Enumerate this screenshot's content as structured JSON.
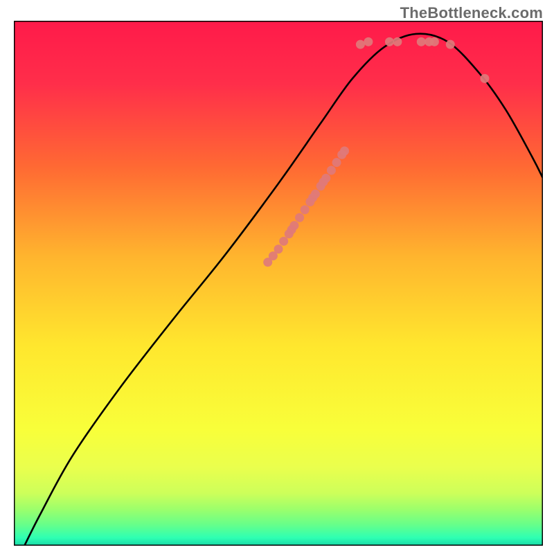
{
  "watermark": "TheBottleneck.com",
  "chart_data": {
    "type": "line",
    "title": "",
    "xlabel": "",
    "ylabel": "",
    "xlim": [
      0,
      100
    ],
    "ylim": [
      0,
      100
    ],
    "gradient_stops": [
      {
        "offset": 0.0,
        "color": "#ff1a4a"
      },
      {
        "offset": 0.12,
        "color": "#ff2e4a"
      },
      {
        "offset": 0.28,
        "color": "#ff6a33"
      },
      {
        "offset": 0.45,
        "color": "#ffb52e"
      },
      {
        "offset": 0.62,
        "color": "#ffe72e"
      },
      {
        "offset": 0.78,
        "color": "#f8ff3a"
      },
      {
        "offset": 0.85,
        "color": "#eaff4d"
      },
      {
        "offset": 0.9,
        "color": "#cdff5a"
      },
      {
        "offset": 0.93,
        "color": "#9dff6b"
      },
      {
        "offset": 0.96,
        "color": "#66ff8a"
      },
      {
        "offset": 0.985,
        "color": "#2effb3"
      },
      {
        "offset": 1.0,
        "color": "#18d9a8"
      }
    ],
    "curve": [
      {
        "x": 2.0,
        "y": 0.0
      },
      {
        "x": 5.0,
        "y": 6.0
      },
      {
        "x": 11.0,
        "y": 17.0
      },
      {
        "x": 20.0,
        "y": 30.0
      },
      {
        "x": 30.0,
        "y": 43.0
      },
      {
        "x": 40.0,
        "y": 55.5
      },
      {
        "x": 50.0,
        "y": 69.0
      },
      {
        "x": 58.0,
        "y": 80.5
      },
      {
        "x": 64.0,
        "y": 89.0
      },
      {
        "x": 70.0,
        "y": 95.0
      },
      {
        "x": 76.0,
        "y": 97.5
      },
      {
        "x": 82.0,
        "y": 96.0
      },
      {
        "x": 88.0,
        "y": 90.0
      },
      {
        "x": 93.0,
        "y": 83.0
      },
      {
        "x": 98.0,
        "y": 74.0
      },
      {
        "x": 100.0,
        "y": 70.0
      }
    ],
    "markers": [
      {
        "x": 48.0,
        "y": 54.0
      },
      {
        "x": 49.0,
        "y": 55.2
      },
      {
        "x": 50.0,
        "y": 56.5
      },
      {
        "x": 51.0,
        "y": 58.0
      },
      {
        "x": 52.0,
        "y": 59.4
      },
      {
        "x": 52.5,
        "y": 60.2
      },
      {
        "x": 53.0,
        "y": 61.0
      },
      {
        "x": 54.0,
        "y": 62.5
      },
      {
        "x": 55.0,
        "y": 64.0
      },
      {
        "x": 56.0,
        "y": 65.5
      },
      {
        "x": 56.5,
        "y": 66.3
      },
      {
        "x": 57.0,
        "y": 67.0
      },
      {
        "x": 58.0,
        "y": 68.5
      },
      {
        "x": 58.5,
        "y": 69.3
      },
      {
        "x": 59.0,
        "y": 70.0
      },
      {
        "x": 60.0,
        "y": 71.5
      },
      {
        "x": 61.0,
        "y": 73.0
      },
      {
        "x": 62.0,
        "y": 74.5
      },
      {
        "x": 62.5,
        "y": 75.2
      },
      {
        "x": 65.5,
        "y": 95.5
      },
      {
        "x": 67.0,
        "y": 96.0
      },
      {
        "x": 71.0,
        "y": 96.0
      },
      {
        "x": 72.5,
        "y": 96.0
      },
      {
        "x": 77.0,
        "y": 96.0
      },
      {
        "x": 78.5,
        "y": 96.0
      },
      {
        "x": 79.5,
        "y": 96.0
      },
      {
        "x": 82.5,
        "y": 95.5
      },
      {
        "x": 89.0,
        "y": 89.0
      }
    ],
    "marker_color": "#e07a7a",
    "curve_color": "#000000"
  }
}
